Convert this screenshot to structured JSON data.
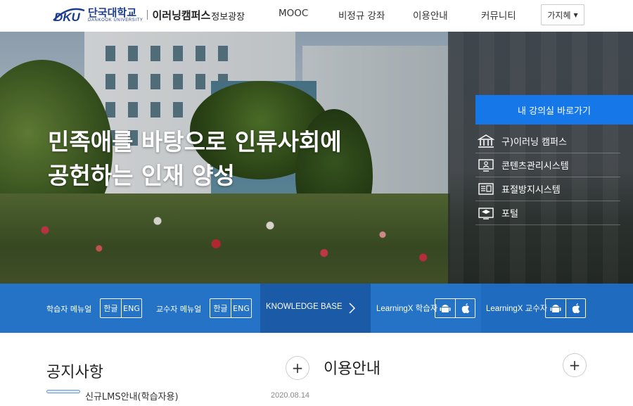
{
  "header": {
    "logo": {
      "mark": "DKU",
      "univ_name": "단국대학교",
      "univ_name_en": "DANKOOK UNIVERSITY",
      "campus": "이러닝캠퍼스",
      "subtitle": "정보광장"
    },
    "nav": [
      "MOOC",
      "비정규 강좌",
      "이용안내",
      "커뮤니티"
    ],
    "language_select": "가지혜"
  },
  "hero": {
    "title_line1": "민족애를 바탕으로 인류사회에",
    "title_line2": "공헌하는 인재 양성",
    "classroom_button": "내 강의실 바로가기",
    "links": [
      {
        "label": "구)이러닝 캠퍼스",
        "icon": "museum-icon"
      },
      {
        "label": "콘텐츠관리시스템",
        "icon": "monitor-icon"
      },
      {
        "label": "표절방지시스템",
        "icon": "document-icon"
      },
      {
        "label": "포털",
        "icon": "graduation-icon"
      }
    ]
  },
  "quickbar": {
    "learner_manual": "학습자 메뉴얼",
    "professor_manual": "교수자 메뉴얼",
    "lang_ko": "한글",
    "lang_en": "ENG",
    "knowledge_base": "KNOWLEDGE BASE",
    "learningx_learner": "LearningX 학습자",
    "learningx_professor": "LearningX 교수자"
  },
  "sections": {
    "notice": {
      "title": "공지사항",
      "items": [
        {
          "title": "신규LMS안내(학습자용)",
          "date": "2020.08.14"
        }
      ]
    },
    "guide": {
      "title": "이용안내"
    },
    "more_symbol": "+"
  },
  "colors": {
    "brand_blue": "#1c3d8c",
    "button_blue": "#1577e8",
    "bar_blue": "#1f6bbf"
  }
}
